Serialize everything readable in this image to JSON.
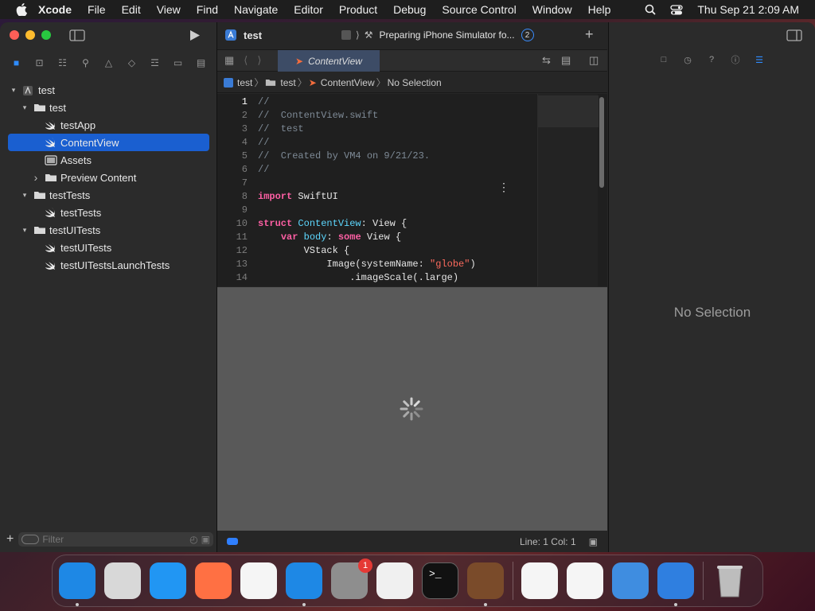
{
  "menubar": {
    "app_name": "Xcode",
    "items": [
      "File",
      "Edit",
      "View",
      "Find",
      "Navigate",
      "Editor",
      "Product",
      "Debug",
      "Source Control",
      "Window",
      "Help"
    ],
    "clock": "Thu Sep 21  2:09 AM"
  },
  "toolbar": {
    "scheme": "test",
    "activity": "Preparing iPhone Simulator fo...",
    "activity_count": "2"
  },
  "tab": {
    "label": "ContentView"
  },
  "jumpbar": [
    "test",
    "test",
    "ContentView",
    "No Selection"
  ],
  "navigator": {
    "items": [
      {
        "label": "test",
        "level": 0,
        "chevron": "open",
        "icon": "project-icon"
      },
      {
        "label": "test",
        "level": 1,
        "chevron": "open",
        "icon": "folder-icon"
      },
      {
        "label": "testApp",
        "level": 2,
        "icon": "swift-icon"
      },
      {
        "label": "ContentView",
        "level": 2,
        "icon": "swift-icon",
        "selected": true
      },
      {
        "label": "Assets",
        "level": 2,
        "icon": "assets-icon"
      },
      {
        "label": "Preview Content",
        "level": 2,
        "chevron": "closed",
        "icon": "folder-icon"
      },
      {
        "label": "testTests",
        "level": 1,
        "chevron": "open",
        "icon": "folder-icon"
      },
      {
        "label": "testTests",
        "level": 2,
        "icon": "swift-icon"
      },
      {
        "label": "testUITests",
        "level": 1,
        "chevron": "open",
        "icon": "folder-icon"
      },
      {
        "label": "testUITests",
        "level": 2,
        "icon": "swift-icon"
      },
      {
        "label": "testUITestsLaunchTests",
        "level": 2,
        "icon": "swift-icon"
      }
    ],
    "filter_placeholder": "Filter"
  },
  "editor": {
    "line_numbers": [
      "1",
      "2",
      "3",
      "4",
      "5",
      "6",
      "7",
      "8",
      "9",
      "10",
      "11",
      "12",
      "13",
      "14"
    ],
    "lines": [
      [
        {
          "t": "//",
          "c": "c"
        }
      ],
      [
        {
          "t": "//  ContentView.swift",
          "c": "c"
        }
      ],
      [
        {
          "t": "//  test",
          "c": "c"
        }
      ],
      [
        {
          "t": "//",
          "c": "c"
        }
      ],
      [
        {
          "t": "//  Created by VM4 on 9/21/23.",
          "c": "c"
        }
      ],
      [
        {
          "t": "//",
          "c": "c"
        }
      ],
      [],
      [
        {
          "t": "import",
          "c": "k"
        },
        {
          "t": " SwiftUI",
          "c": "p"
        }
      ],
      [],
      [
        {
          "t": "struct",
          "c": "k"
        },
        {
          "t": " ",
          "c": "p"
        },
        {
          "t": "ContentView",
          "c": "ty"
        },
        {
          "t": ": View {",
          "c": "p"
        }
      ],
      [
        {
          "t": "    ",
          "c": "p"
        },
        {
          "t": "var",
          "c": "k"
        },
        {
          "t": " ",
          "c": "p"
        },
        {
          "t": "body",
          "c": "ty"
        },
        {
          "t": ": ",
          "c": "p"
        },
        {
          "t": "some",
          "c": "k"
        },
        {
          "t": " View {",
          "c": "p"
        }
      ],
      [
        {
          "t": "        VStack {",
          "c": "p"
        }
      ],
      [
        {
          "t": "            Image(systemName: ",
          "c": "p"
        },
        {
          "t": "\"globe\"",
          "c": "s"
        },
        {
          "t": ")",
          "c": "p"
        }
      ],
      [
        {
          "t": "                .imageScale(.large)",
          "c": "p"
        }
      ]
    ]
  },
  "status": {
    "position": "Line: 1  Col: 1"
  },
  "inspector": {
    "no_selection": "No Selection"
  },
  "dock": {
    "apps": [
      {
        "name": "finder",
        "color": "#1e88e5"
      },
      {
        "name": "launchpad",
        "color": "#d8d8d8"
      },
      {
        "name": "safari",
        "color": "#2196f3"
      },
      {
        "name": "firefox",
        "color": "#ff7043"
      },
      {
        "name": "chrome",
        "color": "#f5f5f5"
      },
      {
        "name": "app-store",
        "color": "#1e88e5"
      },
      {
        "name": "system-settings",
        "color": "#8e8e8e",
        "badge": "1"
      },
      {
        "name": "textedit",
        "color": "#f0f0f0"
      },
      {
        "name": "terminal",
        "color": "#111111"
      },
      {
        "name": "instruments",
        "color": "#7a4b2a"
      },
      {
        "name": "vscode",
        "color": "#f5f5f5"
      },
      {
        "name": "visual-studio",
        "color": "#f5f5f5"
      },
      {
        "name": "weather",
        "color": "#3f8de0"
      },
      {
        "name": "xcode",
        "color": "#2f7fe0"
      },
      {
        "name": "trash",
        "color": "#9a9a9a"
      }
    ]
  },
  "colors": {
    "accent": "#1a5fd0",
    "badge": "#e53935"
  }
}
